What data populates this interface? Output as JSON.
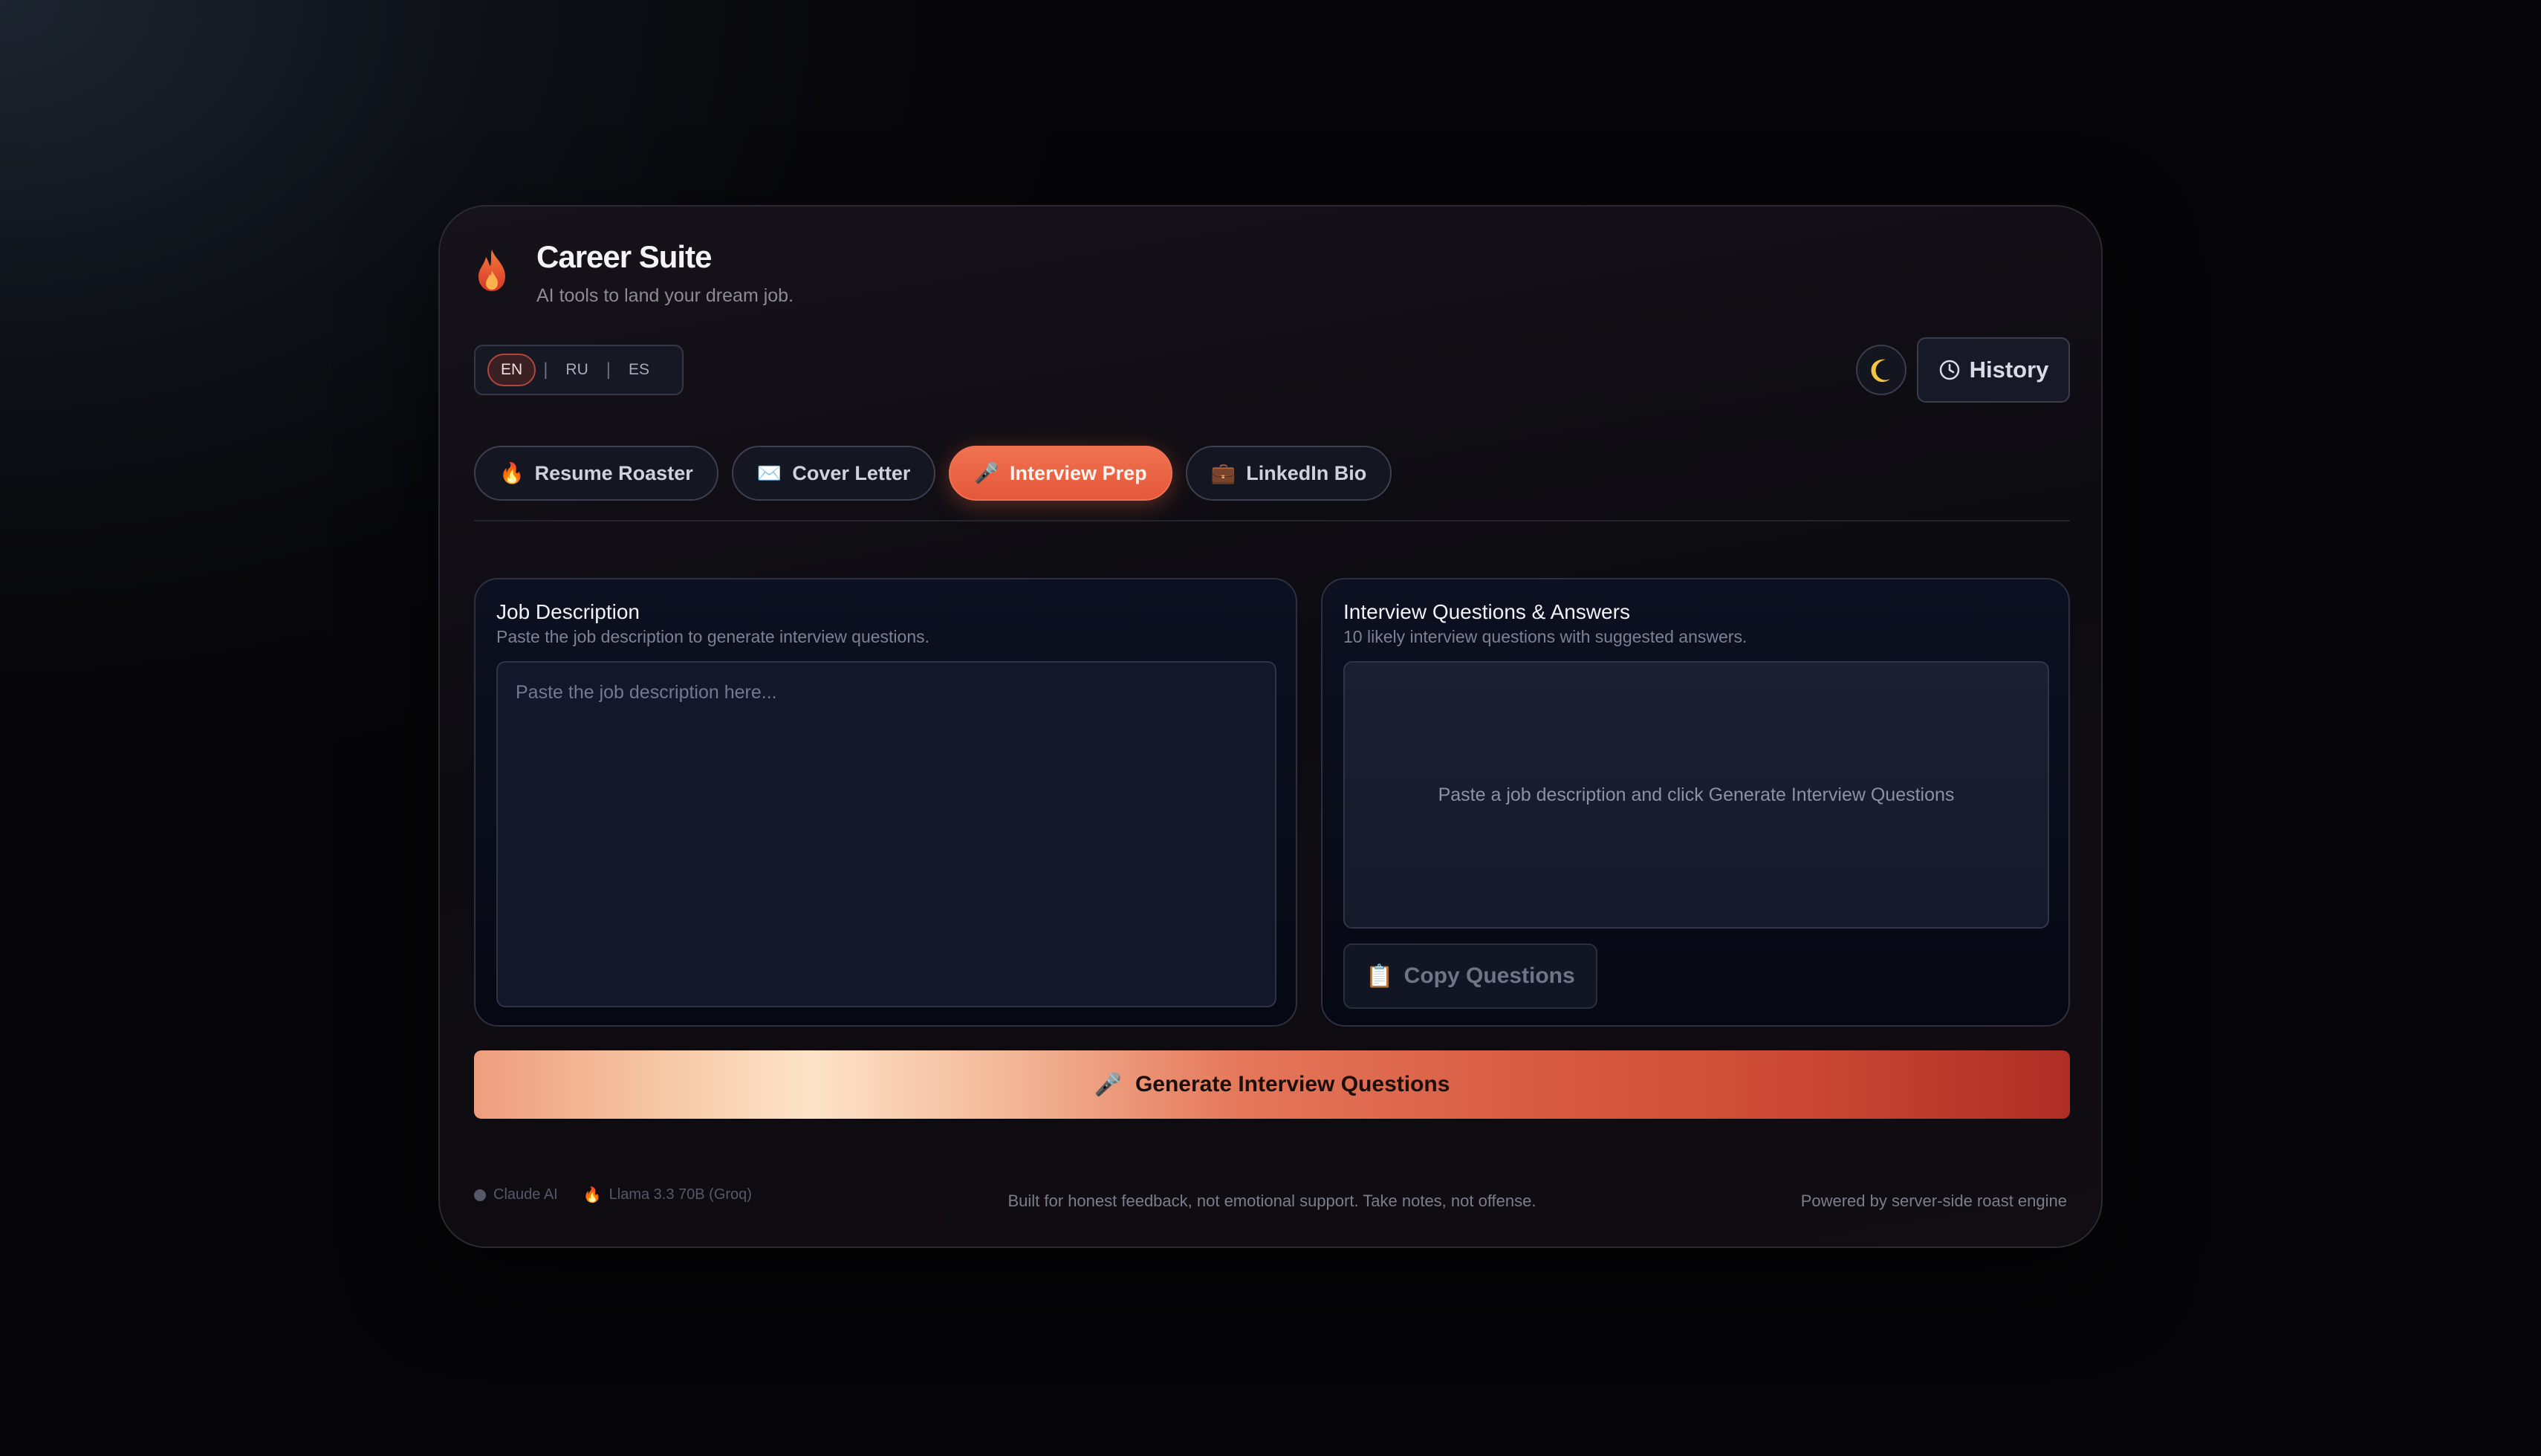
{
  "app": {
    "title": "Career Suite",
    "subtitle": "AI tools to land your dream job."
  },
  "languages": [
    {
      "label": "EN",
      "active": true
    },
    {
      "label": "RU",
      "active": false
    },
    {
      "label": "ES",
      "active": false
    }
  ],
  "header": {
    "theme_icon": "moon-icon",
    "history_label": "History",
    "history_icon": "clock-icon"
  },
  "tabs": [
    {
      "label": "Resume Roaster",
      "icon": "🔥",
      "active": false
    },
    {
      "label": "Cover Letter",
      "icon": "✉️",
      "active": false
    },
    {
      "label": "Interview Prep",
      "icon": "🎤",
      "active": true
    },
    {
      "label": "LinkedIn Bio",
      "icon": "💼",
      "active": false
    }
  ],
  "input_panel": {
    "title": "Job Description",
    "subtitle": "Paste the job description to generate interview questions.",
    "placeholder": "Paste the job description here...",
    "value": ""
  },
  "output_panel": {
    "title": "Interview Questions & Answers",
    "subtitle": "10 likely interview questions with suggested answers.",
    "empty_message": "Paste a job description and click Generate Interview Questions",
    "copy_icon": "📋",
    "copy_label": "Copy Questions"
  },
  "generate": {
    "icon": "🎤",
    "label": "Generate Interview Questions"
  },
  "footer": {
    "models": [
      {
        "label": "Claude AI",
        "icon": "dot-icon"
      },
      {
        "label": "Llama 3.3 70B (Groq)",
        "icon": "🔥"
      }
    ],
    "tagline": "Built for honest feedback, not emotional support. Take notes, not offense.",
    "powered_by": "Powered by server-side roast engine"
  },
  "colors": {
    "accent": "#e4583a",
    "accent_light": "#f07250",
    "background": "#08080b",
    "card": "#0c0b10"
  }
}
